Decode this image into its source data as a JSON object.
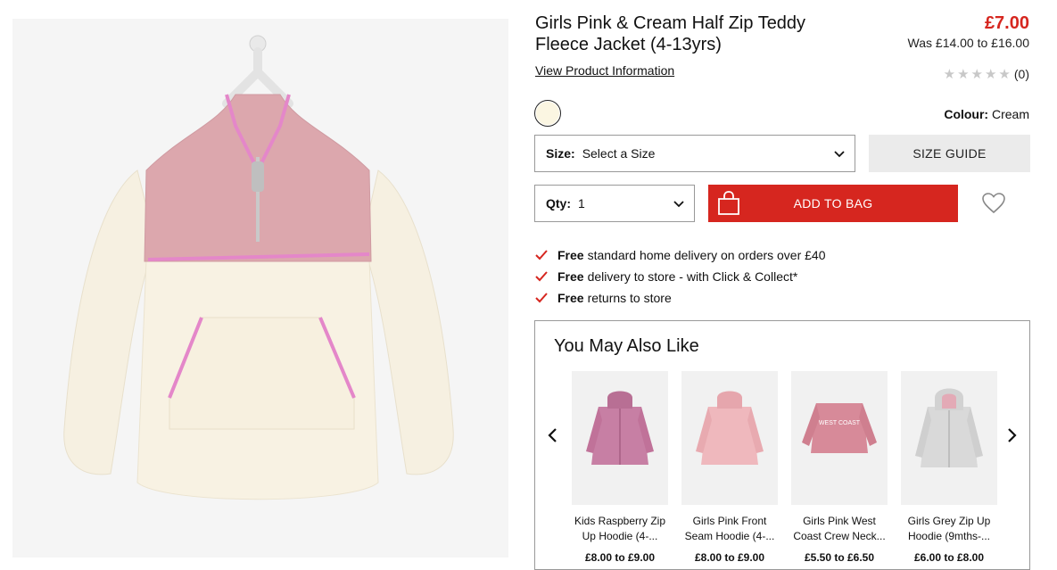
{
  "product": {
    "title_line1": "Girls Pink & Cream Half Zip Teddy",
    "title_line2": "Fleece Jacket (4-13yrs)",
    "price": "£7.00",
    "was_price": "Was £14.00 to £16.00",
    "view_info_link": "View Product Information",
    "rating_count": "(0)",
    "rating_stars": 0,
    "colour_label": "Colour:",
    "colour_value": "Cream",
    "swatch_color": "#fbf6e2"
  },
  "size": {
    "label": "Size:",
    "value": "Select a Size"
  },
  "size_guide": "SIZE GUIDE",
  "qty": {
    "label": "Qty:",
    "value": "1"
  },
  "add_to_bag": "ADD TO BAG",
  "benefits": [
    {
      "bold": "Free",
      "text": "standard home delivery on orders over £40"
    },
    {
      "bold": "Free",
      "text": "delivery to store - with Click & Collect*"
    },
    {
      "bold": "Free",
      "text": "returns to store"
    }
  ],
  "recommendations": {
    "title": "You May Also Like",
    "items": [
      {
        "name": "Kids Raspberry Zip Up Hoodie (4-...",
        "price": "£8.00 to £9.00",
        "color": "#c77fa4"
      },
      {
        "name": "Girls Pink Front Seam Hoodie (4-...",
        "price": "£8.00 to £9.00",
        "color": "#efb8bd"
      },
      {
        "name": "Girls Pink West Coast Crew Neck...",
        "price": "£5.50 to £6.50",
        "color": "#d78a99",
        "print": "WEST COAST"
      },
      {
        "name": "Girls Grey Zip Up Hoodie (9mths-...",
        "price": "£6.00 to £8.00",
        "color": "#d9d9d9"
      }
    ]
  },
  "colors": {
    "accent": "#d6261f",
    "border": "#999999",
    "guide_bg": "#ebebeb"
  }
}
